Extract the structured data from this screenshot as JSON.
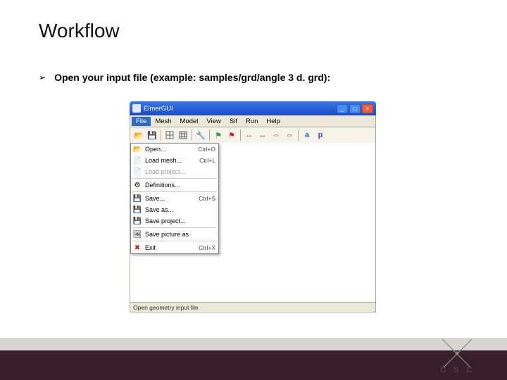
{
  "slide": {
    "title": "Workflow",
    "bullet_text": "Open your input file (example: samples/grd/angle 3 d. grd):",
    "bullet_glyph": "➢"
  },
  "window": {
    "title": "ElmerGUI",
    "min": "_",
    "max": "□",
    "close": "×"
  },
  "menubar": {
    "items": [
      "File",
      "Mesh",
      "Model",
      "View",
      "Sif",
      "Run",
      "Help"
    ]
  },
  "toolbar": {
    "icons": [
      "folder",
      "disk",
      "sep",
      "mesh1",
      "mesh2",
      "sep",
      "wrench",
      "sep",
      "flag-green",
      "flag-red",
      "sep",
      "arrows-red",
      "arrows-dkred",
      "arrows-red2",
      "arrows-dkred2",
      "sep",
      "a",
      "p"
    ]
  },
  "file_menu": {
    "items": [
      {
        "icon": "📂",
        "label": "Open...",
        "shortcut": "Ctrl+O",
        "enabled": true
      },
      {
        "icon": "📄",
        "label": "Load mesh...",
        "shortcut": "Ctrl+L",
        "enabled": true
      },
      {
        "icon": "📄",
        "label": "Load project...",
        "shortcut": "",
        "enabled": false
      },
      {
        "sep": true
      },
      {
        "icon": "⚙",
        "label": "Definitions...",
        "shortcut": "",
        "enabled": true
      },
      {
        "sep": true
      },
      {
        "icon": "💾",
        "label": "Save...",
        "shortcut": "Ctrl+S",
        "enabled": true
      },
      {
        "icon": "💾",
        "label": "Save as...",
        "shortcut": "",
        "enabled": true
      },
      {
        "icon": "💾",
        "label": "Save project...",
        "shortcut": "",
        "enabled": true
      },
      {
        "sep": true
      },
      {
        "icon": "🖼",
        "label": "Save picture as",
        "shortcut": "",
        "enabled": true
      },
      {
        "sep": true
      },
      {
        "icon": "✖",
        "label": "Exit",
        "shortcut": "Ctrl+X",
        "enabled": true
      }
    ]
  },
  "statusbar": {
    "text": "Open geometry input file"
  },
  "logo": {
    "text": "C S C"
  }
}
